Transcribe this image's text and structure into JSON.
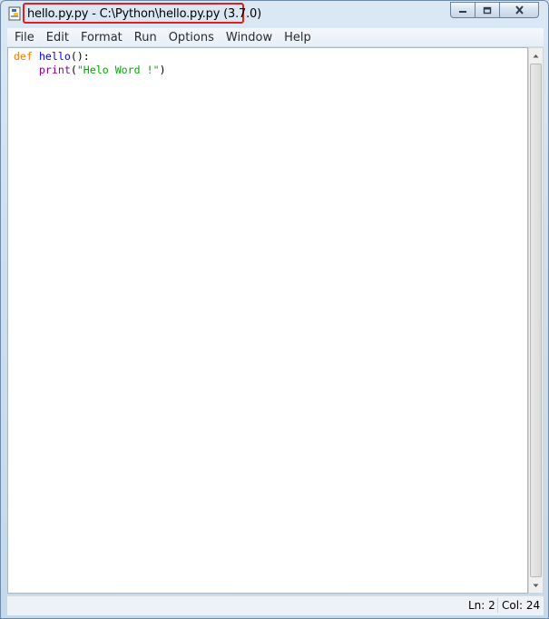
{
  "window": {
    "title": "hello.py.py - C:\\Python\\hello.py.py (3.7.0)",
    "icons": {
      "app": "python-idle-icon",
      "minimize": "minimize-icon",
      "maximize": "restore-icon",
      "close": "close-icon"
    }
  },
  "menubar": {
    "items": [
      "File",
      "Edit",
      "Format",
      "Run",
      "Options",
      "Window",
      "Help"
    ]
  },
  "editor": {
    "lines": [
      {
        "tokens": [
          {
            "text": "def",
            "type": "keyword"
          },
          {
            "text": " ",
            "type": "plain"
          },
          {
            "text": "hello",
            "type": "definition"
          },
          {
            "text": "():",
            "type": "plain"
          }
        ]
      },
      {
        "tokens": [
          {
            "text": "    ",
            "type": "plain"
          },
          {
            "text": "print",
            "type": "builtin"
          },
          {
            "text": "(",
            "type": "plain"
          },
          {
            "text": "\"Helo Word !\"",
            "type": "string"
          },
          {
            "text": ")",
            "type": "plain"
          }
        ]
      }
    ],
    "syntax_colors": {
      "keyword": "#ff7700",
      "definition": "#0000ff",
      "builtin": "#900090",
      "string": "#00aa00",
      "plain": "#000000"
    }
  },
  "statusbar": {
    "line": "Ln: 2",
    "column": "Col: 24"
  },
  "highlight_color": "#e02020"
}
